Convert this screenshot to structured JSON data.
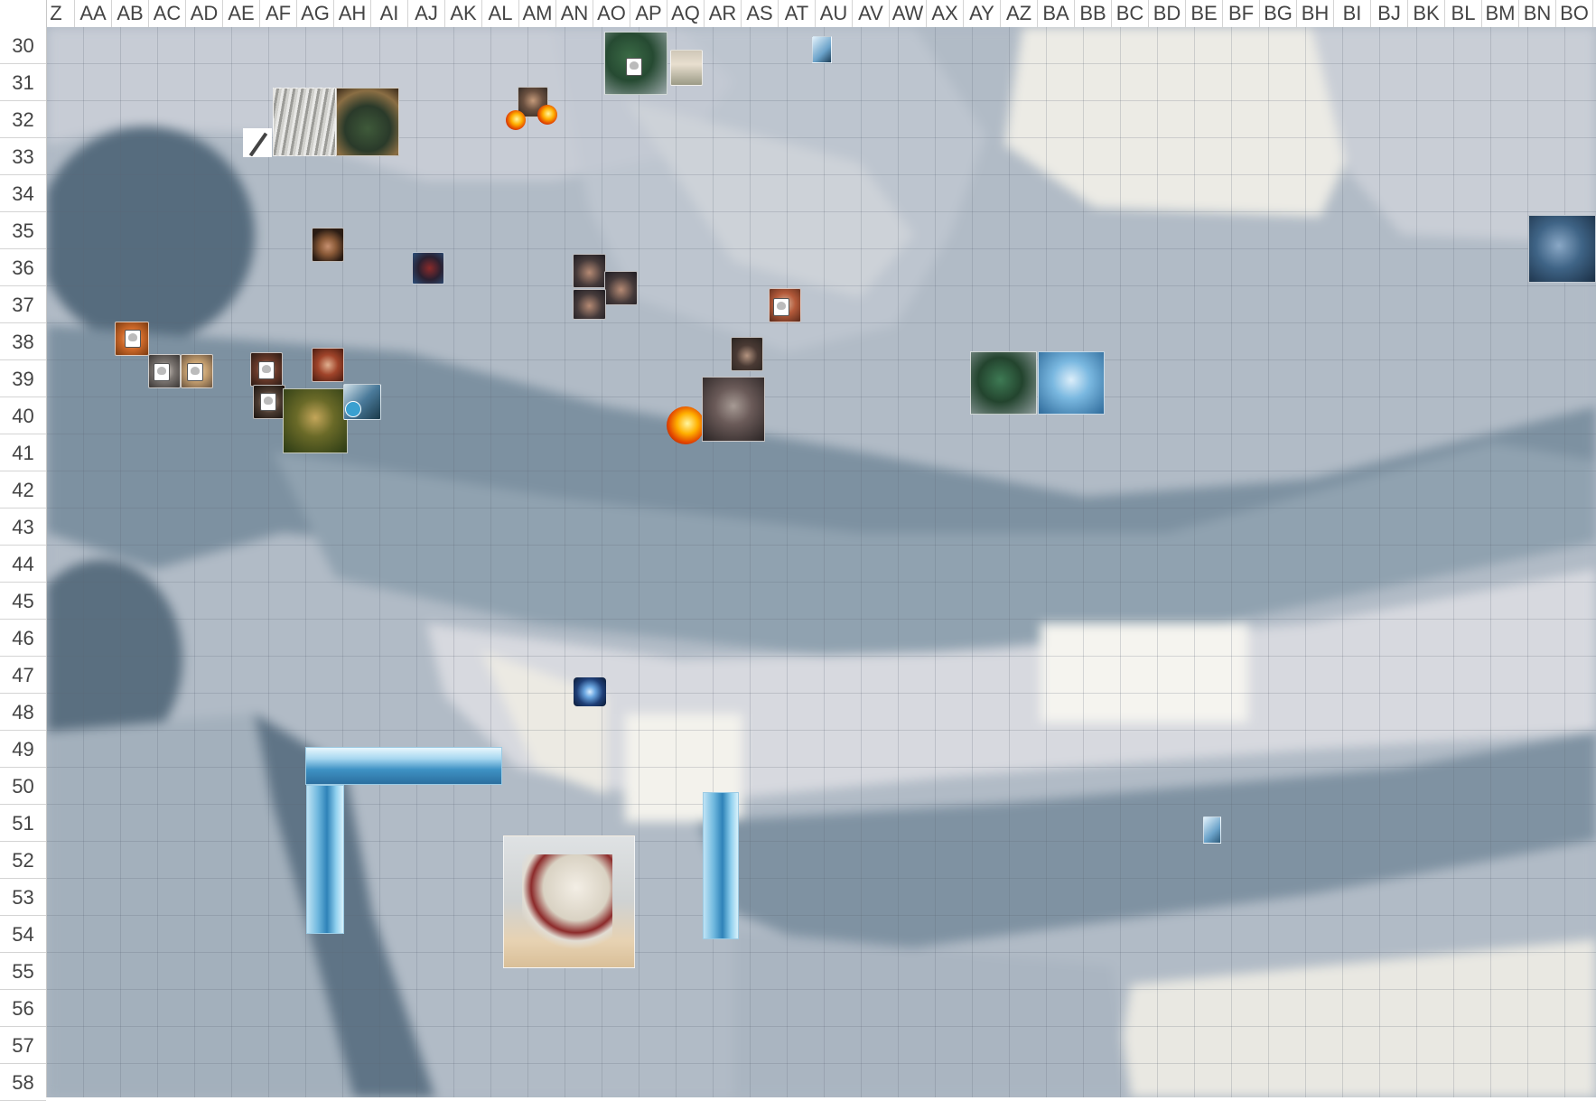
{
  "columns": [
    "Z",
    "AA",
    "AB",
    "AC",
    "AD",
    "AE",
    "AF",
    "AG",
    "AH",
    "AI",
    "AJ",
    "AK",
    "AL",
    "AM",
    "AN",
    "AO",
    "AP",
    "AQ",
    "AR",
    "AS",
    "AT",
    "AU",
    "AV",
    "AW",
    "AX",
    "AY",
    "AZ",
    "BA",
    "BB",
    "BC",
    "BD",
    "BE",
    "BF",
    "BG",
    "BH",
    "BI",
    "BJ",
    "BK",
    "BL",
    "BM",
    "BN",
    "BO"
  ],
  "rows": [
    "30",
    "31",
    "32",
    "33",
    "34",
    "35",
    "36",
    "37",
    "38",
    "39",
    "40",
    "41",
    "42",
    "43",
    "44",
    "45",
    "46",
    "47",
    "48",
    "49",
    "50",
    "51",
    "52",
    "53",
    "54",
    "55",
    "56",
    "57",
    "58"
  ],
  "colors": {
    "map_base": "#aeb8c4",
    "map_light": "#d6d9e0",
    "map_dark": "#5b6f80",
    "map_white": "#f2f1ec",
    "grid": "#5a6473"
  },
  "tokens": [
    {
      "name": "green-dragon-token",
      "icon": "dragon-icon"
    },
    {
      "name": "elf-woman-token",
      "icon": "elf-icon"
    },
    {
      "name": "gray-warg-token",
      "icon": "beast-icon"
    },
    {
      "name": "horned-orc-token",
      "icon": "orc-icon"
    },
    {
      "name": "bearded-man-token",
      "icon": "human-icon"
    },
    {
      "name": "blue-ice-creature-token",
      "icon": "troll-icon"
    },
    {
      "name": "white-dragon-figure-token",
      "icon": "dragon-icon"
    },
    {
      "name": "green-dragon-head-token",
      "icon": "dragon-icon"
    },
    {
      "name": "frost-yeti-token",
      "icon": "yeti-icon"
    },
    {
      "name": "orc-brute-token",
      "icon": "orc-icon"
    },
    {
      "name": "swamp-creature-token",
      "icon": "creature-icon"
    }
  ]
}
